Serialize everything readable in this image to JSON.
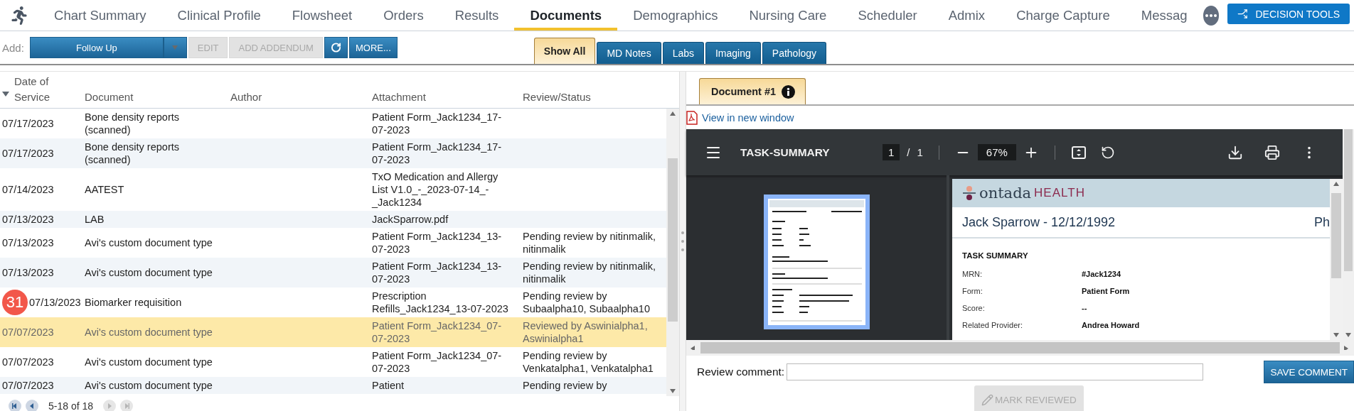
{
  "nav": {
    "items": [
      {
        "label": "Chart Summary",
        "selected": false
      },
      {
        "label": "Clinical Profile",
        "selected": false
      },
      {
        "label": "Flowsheet",
        "selected": false
      },
      {
        "label": "Orders",
        "selected": false
      },
      {
        "label": "Results",
        "selected": false
      },
      {
        "label": "Documents",
        "selected": true
      },
      {
        "label": "Demographics",
        "selected": false
      },
      {
        "label": "Nursing Care",
        "selected": false
      },
      {
        "label": "Scheduler",
        "selected": false
      },
      {
        "label": "Admix",
        "selected": false
      },
      {
        "label": "Charge Capture",
        "selected": false
      },
      {
        "label": "Messag",
        "selected": false
      }
    ],
    "action_button": "DECISION TOOLS"
  },
  "toolbar": {
    "add_label": "Add:",
    "add_value": "Follow Up",
    "buttons": [
      {
        "kind": "text",
        "label": "EDIT",
        "disabled": true
      },
      {
        "kind": "text",
        "label": "ADD ADDENDUM",
        "disabled": true
      },
      {
        "kind": "refresh",
        "disabled": false
      },
      {
        "kind": "text",
        "label": "MORE...",
        "disabled": false
      }
    ]
  },
  "filter_tabs": [
    {
      "label": "Show All",
      "selected": true
    },
    {
      "label": "MD Notes",
      "selected": false
    },
    {
      "label": "Labs",
      "selected": false
    },
    {
      "label": "Imaging",
      "selected": false
    },
    {
      "label": "Pathology",
      "selected": false
    }
  ],
  "table": {
    "columns": [
      "Date of Service",
      "Document",
      "Author",
      "Attachment",
      "Review/Status"
    ],
    "rows": [
      {
        "date": "07/17/2023",
        "document": "Bone density reports (scanned)",
        "attachment": "Patient Form_Jack1234_17-07-2023",
        "selected": false
      },
      {
        "date": "07/17/2023",
        "document": "Bone density reports (scanned)",
        "attachment": "Patient Form_Jack1234_17-07-2023",
        "selected": false
      },
      {
        "date": "07/14/2023",
        "document": "AATEST",
        "attachment": "TxO Medication and Allergy List V1.0_-_2023-07-14_-_Jack1234",
        "selected": false
      },
      {
        "date": "07/13/2023",
        "document": "LAB",
        "attachment": "JackSparrow.pdf",
        "selected": false
      },
      {
        "date": "07/13/2023",
        "document": "Avi's custom document type",
        "attachment": "Patient Form_Jack1234_13-07-2023",
        "status": "Pending review by nitinmalik, nitinmalik",
        "selected": false
      },
      {
        "date": "07/13/2023",
        "document": "Avi's custom document type",
        "attachment": "Patient Form_Jack1234_13-07-2023",
        "status": "Pending review by nitinmalik, nitinmalik",
        "selected": false
      },
      {
        "date": "07/13/2023",
        "badge": "31",
        "document": "Biomarker requisition",
        "attachment": "Prescription Refills_Jack1234_13-07-2023",
        "status": "Pending review by Subaalpha10, Subaalpha10",
        "selected": false
      },
      {
        "date": "07/07/2023",
        "document": "Avi's custom document type",
        "attachment": "Patient Form_Jack1234_07-07-2023",
        "status": "Reviewed by Aswinialpha1, Aswinialpha1",
        "selected": true
      },
      {
        "date": "07/07/2023",
        "document": "Avi's custom document type",
        "attachment": "Patient Form_Jack1234_07-07-2023",
        "status": "Pending review by Venkatalpha1, Venkatalpha1",
        "selected": false
      },
      {
        "date": "07/07/2023",
        "document": "Avi's custom document type",
        "attachment": "Patient",
        "status": "Pending review by",
        "selected": false
      }
    ]
  },
  "pagination": {
    "range": "5-18 of 18",
    "buttons": [
      {
        "kind": "first",
        "disabled": false
      },
      {
        "kind": "prev",
        "disabled": false
      },
      {
        "kind": "next",
        "disabled": true
      },
      {
        "kind": "last",
        "disabled": true
      }
    ]
  },
  "viewer": {
    "tabs": [
      {
        "label": "Document #1",
        "selected": true
      }
    ],
    "link": "View in new window",
    "pdf": {
      "title": "TASK-SUMMARY",
      "page": "1",
      "separator": "/",
      "pages": "1",
      "zoom": "67%",
      "brand": "ontada",
      "brand_suffix": "HEALTH",
      "patient": "Jack Sparrow - 12/12/1992",
      "patient_right": "Ph",
      "section": "TASK SUMMARY",
      "fields": [
        {
          "label": "MRN:",
          "value": "#Jack1234"
        },
        {
          "label": "Form:",
          "value": "Patient Form"
        },
        {
          "label": "Score:",
          "value": "--"
        },
        {
          "label": "Related Provider:",
          "value": "Andrea Howard"
        }
      ]
    },
    "review": {
      "label": "Review comment:",
      "save": "SAVE COMMENT",
      "mark": "MARK REVIEWED",
      "mark_disabled": true
    }
  }
}
